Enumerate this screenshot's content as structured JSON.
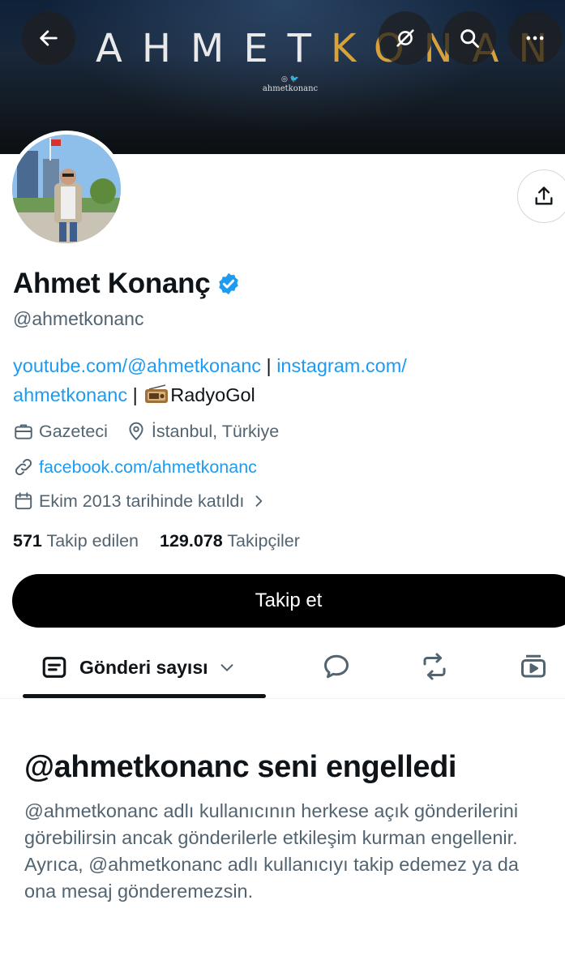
{
  "banner": {
    "title_part1": "AHMET",
    "title_part2": "KONANÇ",
    "social_handle": "ahmetkonanc",
    "social_icons": "◎ 🐦"
  },
  "top_bar": {
    "back_icon": "arrow-left-icon",
    "grok_icon": "slash-circle-icon",
    "search_icon": "search-icon",
    "more_icon": "more-dots-icon"
  },
  "profile": {
    "name": "Ahmet Konanç",
    "handle": "@ahmetkonanc",
    "verified": true,
    "bio": {
      "link1": "youtube.com/@ahmetkonanc",
      "sep1": " | ",
      "link2_part1": "instagram.com/",
      "link2_part2": "ahmetkonanc",
      "sep2": " | ",
      "tail": "RadyoGol"
    },
    "profession": "Gazeteci",
    "location": "İstanbul, Türkiye",
    "website": "facebook.com/ahmetkonanc",
    "joined": "Ekim 2013 tarihinde katıldı",
    "following_count": "571",
    "following_label": "Takip edilen",
    "followers_count": "129.078",
    "followers_label": "Takipçiler",
    "follow_button": "Takip et"
  },
  "tabs": {
    "main_label": "Gönderi sayısı"
  },
  "blocked": {
    "title": "@ahmetkonanc seni engelledi",
    "body": "@ahmetkonanc adlı kullanıcının herkese açık gönderilerini görebilirsin ancak gönderilerle etkileşim kurman engellenir. Ayrıca, @ahmetkonanc adlı kullanıcıyı takip edemez ya da ona mesaj gönderemezsin."
  },
  "colors": {
    "link": "#1d9bf0",
    "secondary_text": "#536471",
    "banner_accent": "#d8a23a",
    "button_bg": "#000000"
  }
}
